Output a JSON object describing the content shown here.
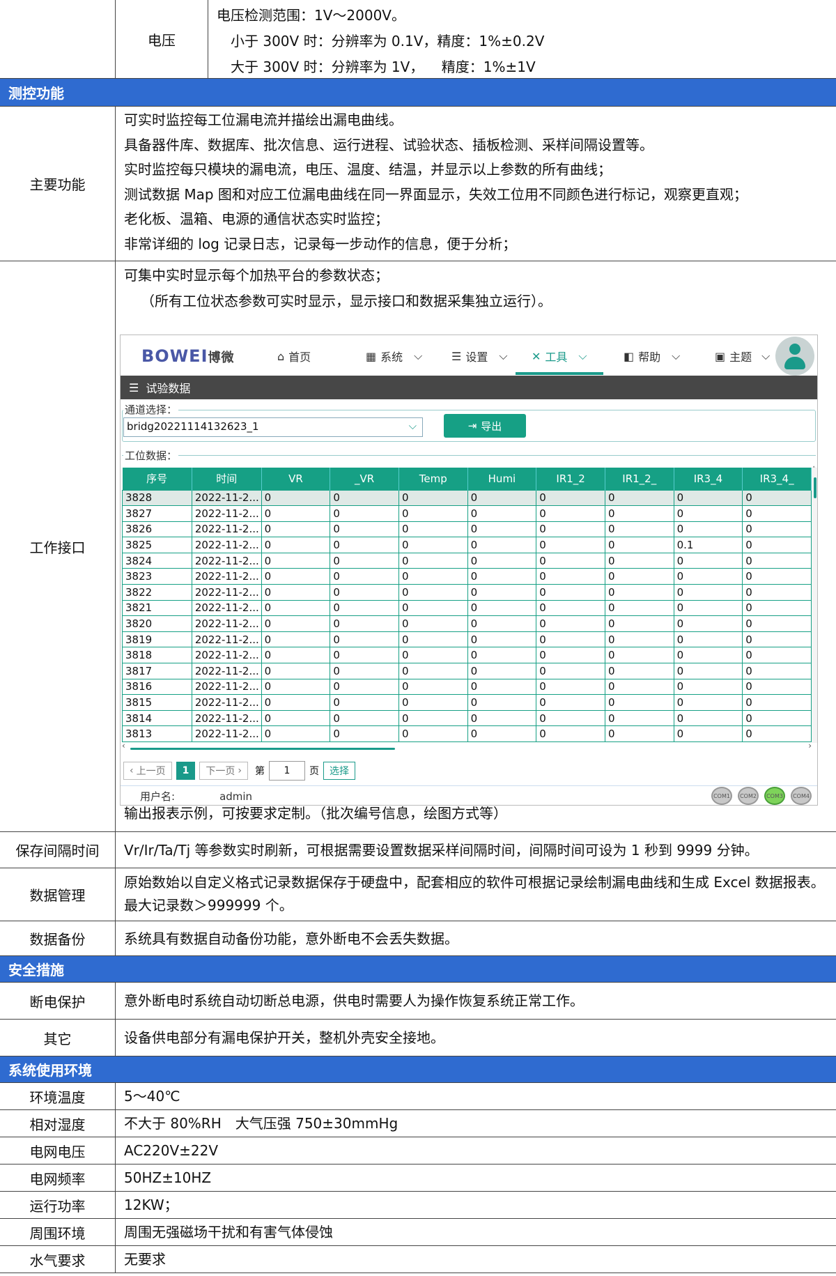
{
  "top_row": {
    "sub_label": "电压",
    "lines": [
      "电压检测范围：1V～2000V。",
      "小于 300V 时：分辨率为 0.1V，精度：1%±0.2V",
      "大于 300V 时：分辨率为 1V，    精度：1%±1V"
    ]
  },
  "sections": {
    "control": "测控功能",
    "safety": "安全措施",
    "env": "系统使用环境"
  },
  "main_function": {
    "label": "主要功能",
    "lines": [
      "可实时监控每工位漏电流并描绘出漏电曲线。",
      "具备器件库、数据库、批次信息、运行进程、试验状态、插板检测、采样间隔设置等。",
      "实时监控每只模块的漏电流，电压、温度、结温，并显示以上参数的所有曲线；",
      "测试数据 Map 图和对应工位漏电曲线在同一界面显示，失效工位用不同颜色进行标记，观察更直观；",
      "老化板、温箱、电源的通信状态实时监控；",
      "非常详细的 log 记录日志，记录每一步动作的信息，便于分析；"
    ]
  },
  "work_interface": {
    "label": "工作接口",
    "lines": [
      "可集中实时显示每个加热平台的参数状态；",
      "（所有工位状态参数可实时显示，显示接口和数据采集独立运行）。"
    ],
    "caption": "输出报表示例，可按要求定制。（批次编号信息，绘图方式等）",
    "app": {
      "logo": "BOWEI",
      "logo_cn": "博微",
      "nav": [
        {
          "icon": "home-icon",
          "label": "首页"
        },
        {
          "icon": "windows-icon",
          "label": "系统"
        },
        {
          "icon": "list-icon",
          "label": "设置"
        },
        {
          "icon": "tools-icon",
          "label": "工具"
        },
        {
          "icon": "help-icon",
          "label": "帮助"
        },
        {
          "icon": "theme-icon",
          "label": "主题"
        }
      ],
      "bar_title": "试验数据",
      "channel_legend": "通道选择：",
      "channel_value": "bridg20221114132623_1",
      "export_label": "导出",
      "station_legend": "工位数据：",
      "columns": [
        "序号",
        "时间",
        "VR",
        "_VR",
        "Temp",
        "Humi",
        "IR1_2",
        "IR1_2_",
        "IR3_4",
        "IR3_4_"
      ],
      "rows": [
        [
          "3828",
          "2022-11-2...",
          "0",
          "0",
          "0",
          "0",
          "0",
          "0",
          "0",
          "0"
        ],
        [
          "3827",
          "2022-11-2...",
          "0",
          "0",
          "0",
          "0",
          "0",
          "0",
          "0",
          "0"
        ],
        [
          "3826",
          "2022-11-2...",
          "0",
          "0",
          "0",
          "0",
          "0",
          "0",
          "0",
          "0"
        ],
        [
          "3825",
          "2022-11-2...",
          "0",
          "0",
          "0",
          "0",
          "0",
          "0",
          "0.1",
          "0"
        ],
        [
          "3824",
          "2022-11-2...",
          "0",
          "0",
          "0",
          "0",
          "0",
          "0",
          "0",
          "0"
        ],
        [
          "3823",
          "2022-11-2...",
          "0",
          "0",
          "0",
          "0",
          "0",
          "0",
          "0",
          "0"
        ],
        [
          "3822",
          "2022-11-2...",
          "0",
          "0",
          "0",
          "0",
          "0",
          "0",
          "0",
          "0"
        ],
        [
          "3821",
          "2022-11-2...",
          "0",
          "0",
          "0",
          "0",
          "0",
          "0",
          "0",
          "0"
        ],
        [
          "3820",
          "2022-11-2...",
          "0",
          "0",
          "0",
          "0",
          "0",
          "0",
          "0",
          "0"
        ],
        [
          "3819",
          "2022-11-2...",
          "0",
          "0",
          "0",
          "0",
          "0",
          "0",
          "0",
          "0"
        ],
        [
          "3818",
          "2022-11-2...",
          "0",
          "0",
          "0",
          "0",
          "0",
          "0",
          "0",
          "0"
        ],
        [
          "3817",
          "2022-11-2...",
          "0",
          "0",
          "0",
          "0",
          "0",
          "0",
          "0",
          "0"
        ],
        [
          "3816",
          "2022-11-2...",
          "0",
          "0",
          "0",
          "0",
          "0",
          "0",
          "0",
          "0"
        ],
        [
          "3815",
          "2022-11-2...",
          "0",
          "0",
          "0",
          "0",
          "0",
          "0",
          "0",
          "0"
        ],
        [
          "3814",
          "2022-11-2...",
          "0",
          "0",
          "0",
          "0",
          "0",
          "0",
          "0",
          "0"
        ],
        [
          "3813",
          "2022-11-2...",
          "0",
          "0",
          "0",
          "0",
          "0",
          "0",
          "0",
          "0"
        ]
      ],
      "pager": {
        "prev": "上一页",
        "current": "1",
        "next": "下一页",
        "page_prefix": "第",
        "page_value": "1",
        "page_suffix": "页",
        "go": "选择"
      },
      "user_label": "用户名:",
      "user_value": "admin",
      "com_ports": [
        {
          "label": "COM1",
          "active": false
        },
        {
          "label": "COM2",
          "active": false
        },
        {
          "label": "COM3",
          "active": true
        },
        {
          "label": "COM4",
          "active": false
        }
      ]
    }
  },
  "rows_mid": [
    {
      "label": "保存间隔时间",
      "value": "Vr/Ir/Ta/Tj 等参数实时刷新，可根据需要设置数据采样间隔时间，间隔时间可设为 1 秒到 9999 分钟。"
    },
    {
      "label": "数据管理",
      "value": "原始数始以自定义格式记录数据保存于硬盘中，配套相应的软件可根据记录绘制漏电曲线和生成 Excel 数据报表。最大记录数＞999999 个。"
    },
    {
      "label": "数据备份",
      "value": "系统具有数据自动备份功能，意外断电不会丢失数据。"
    }
  ],
  "rows_safety": [
    {
      "label": "断电保护",
      "value": "意外断电时系统自动切断总电源，供电时需要人为操作恢复系统正常工作。"
    },
    {
      "label": "其它",
      "value": "设备供电部分有漏电保护开关，整机外壳安全接地。"
    }
  ],
  "rows_env": [
    {
      "label": "环境温度",
      "value": "5～40℃"
    },
    {
      "label": "相对湿度",
      "value": "不大于 80%RH　大气压强 750±30mmHg"
    },
    {
      "label": "电网电压",
      "value": "AC220V±22V"
    },
    {
      "label": "电网频率",
      "value": "50HZ±10HZ"
    },
    {
      "label": "运行功率",
      "value": "12KW；"
    },
    {
      "label": "周围环境",
      "value": "周围无强磁场干扰和有害气体侵蚀"
    },
    {
      "label": "水气要求",
      "value": "无要求"
    }
  ],
  "colors": {
    "section_header": "#2f6bd0",
    "app_accent": "#16a085",
    "app_bar": "#474747"
  }
}
